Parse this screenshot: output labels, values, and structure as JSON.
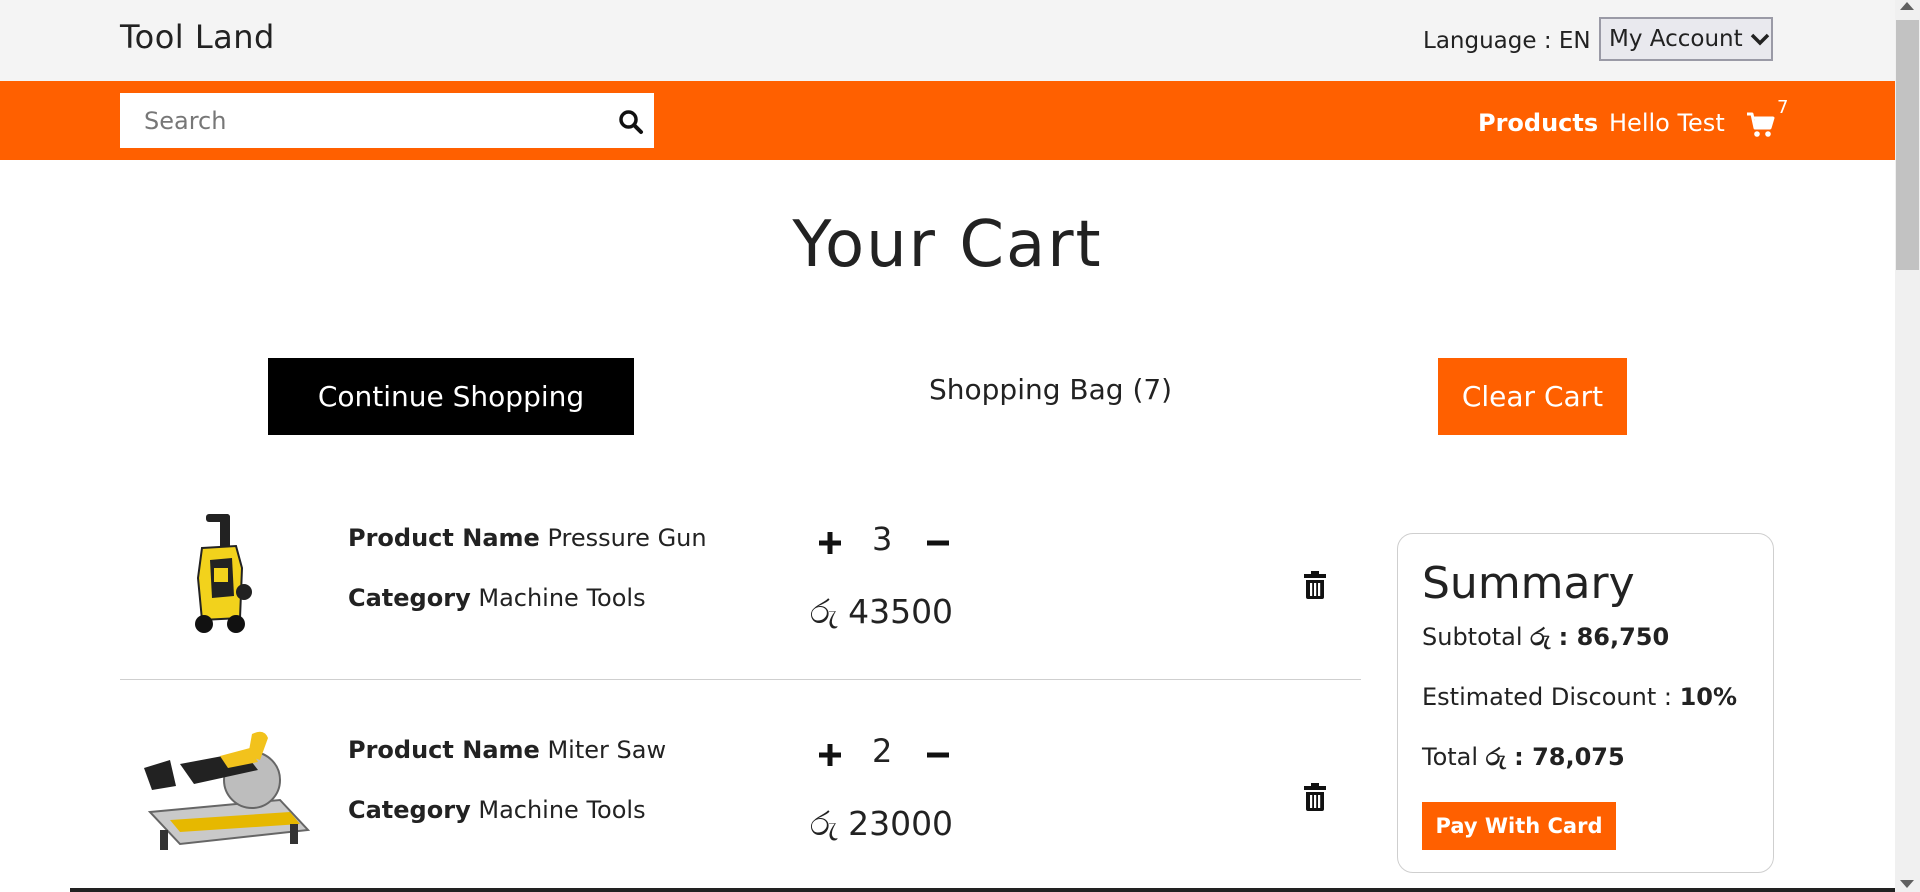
{
  "header": {
    "brand": "Tool Land",
    "language_label": "Language : EN",
    "account_label": "My Account"
  },
  "nav": {
    "search_placeholder": "Search",
    "products_label": "Products",
    "greeting": "Hello Test",
    "cart_count": "7"
  },
  "page": {
    "title": "Your Cart",
    "continue_label": "Continue Shopping",
    "bag_label": "Shopping Bag (7)",
    "clear_label": "Clear Cart"
  },
  "cart": {
    "items": [
      {
        "name_label": "Product Name",
        "name": "Pressure Gun",
        "category_label": "Category",
        "category": "Machine Tools",
        "quantity": "3",
        "price": "රු 43500"
      },
      {
        "name_label": "Product Name",
        "name": "Miter Saw",
        "category_label": "Category",
        "category": "Machine Tools",
        "quantity": "2",
        "price": "රු 23000"
      }
    ]
  },
  "summary": {
    "title": "Summary",
    "subtotal_label": "Subtotal",
    "subtotal_value": "රු : 86,750",
    "discount_label": "Estimated Discount :",
    "discount_value": "10%",
    "total_label": "Total",
    "total_value": "රු : 78,075",
    "pay_label": "Pay With Card"
  },
  "colors": {
    "accent": "#ff6000",
    "dark": "#000000",
    "topbar": "#f4f4f4"
  },
  "icons": [
    "search-icon",
    "cart-icon",
    "chevron-down-icon",
    "plus-icon",
    "minus-icon",
    "trash-icon"
  ]
}
